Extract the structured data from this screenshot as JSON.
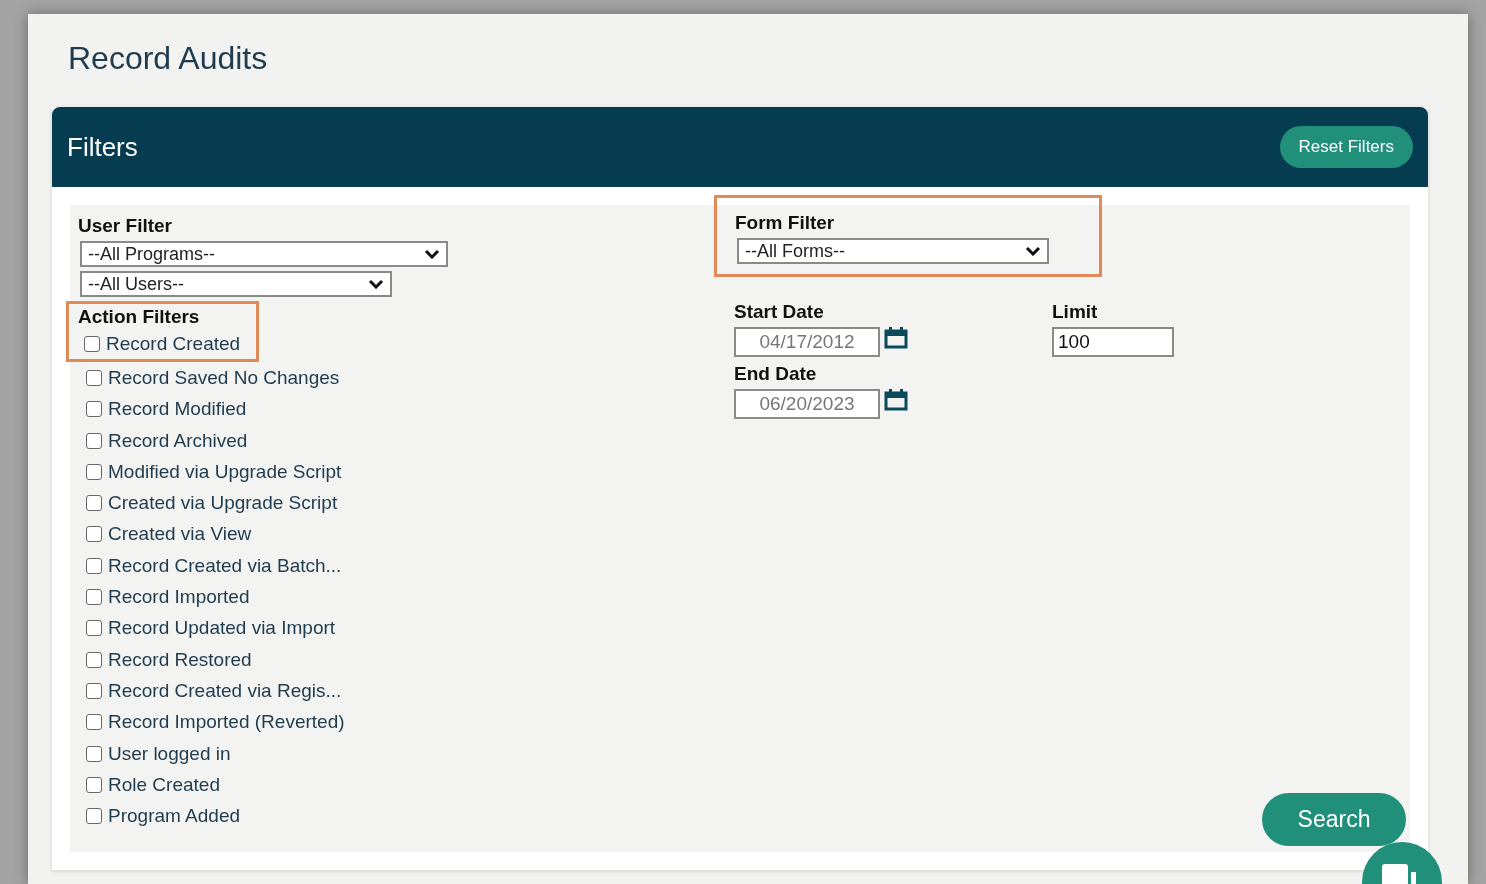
{
  "page_title": "Record Audits",
  "filters_panel": {
    "title": "Filters",
    "reset_button": "Reset Filters"
  },
  "user_filter": {
    "label": "User Filter",
    "dropdowns": [
      {
        "value": "--All Programs--"
      },
      {
        "value": "--All Users--"
      }
    ]
  },
  "action_filters": {
    "label": "Action Filters",
    "highlighted": true,
    "items": [
      {
        "label": "Record Created",
        "checked": false
      },
      {
        "label": "Record Saved No Changes",
        "checked": false
      },
      {
        "label": "Record Modified",
        "checked": false
      },
      {
        "label": "Record Archived",
        "checked": false
      },
      {
        "label": "Modified via Upgrade Script",
        "checked": false
      },
      {
        "label": "Created via Upgrade Script",
        "checked": false
      },
      {
        "label": "Created via View",
        "checked": false
      },
      {
        "label": "Record Created via Batch...",
        "checked": false
      },
      {
        "label": "Record Imported",
        "checked": false
      },
      {
        "label": "Record Updated via Import",
        "checked": false
      },
      {
        "label": "Record Restored",
        "checked": false
      },
      {
        "label": "Record Created via Regis...",
        "checked": false
      },
      {
        "label": "Record Imported (Reverted)",
        "checked": false
      },
      {
        "label": "User logged in",
        "checked": false
      },
      {
        "label": "Role Created",
        "checked": false
      },
      {
        "label": "Program Added",
        "checked": false
      }
    ]
  },
  "form_filter": {
    "label": "Form Filter",
    "value": "--All Forms--",
    "highlighted": true
  },
  "start_date": {
    "label": "Start Date",
    "value": "04/17/2012",
    "disabled": true
  },
  "end_date": {
    "label": "End Date",
    "value": "06/20/2023",
    "disabled": true
  },
  "limit": {
    "label": "Limit",
    "value": "100"
  },
  "search_button": "Search"
}
